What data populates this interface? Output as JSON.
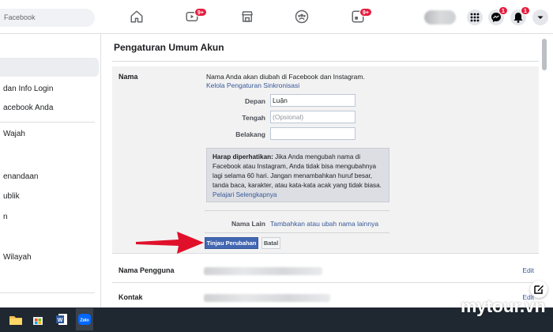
{
  "topbar": {
    "search_text": "Facebook",
    "notifications_badges": {
      "video": "9+",
      "groups_gaming": "9+",
      "messenger": "1",
      "notifications": "1"
    }
  },
  "sidebar": {
    "items": [
      {
        "label": "dan Info Login"
      },
      {
        "label": "acebook Anda"
      },
      {
        "label": "Wajah"
      },
      {
        "label": "enandaan"
      },
      {
        "label": "ublik"
      },
      {
        "label": "n"
      },
      {
        "label": "Wilayah"
      }
    ]
  },
  "main": {
    "title": "Pengaturan Umum Akun",
    "name_section": {
      "label": "Nama",
      "intro": "Nama Anda akan diubah di Facebook dan Instagram.",
      "sync_link": "Kelola Pengaturan Sinkronisasi",
      "first_label": "Depan",
      "first_value": "Luận",
      "middle_label": "Tengah",
      "middle_placeholder": "(Opsional)",
      "last_label": "Belakang",
      "last_value": "",
      "notice_bold": "Harap diperhatikan:",
      "notice_text": "Jika Anda mengubah nama di Facebook atau Instagram, Anda tidak bisa mengubahnya lagi selama 60 hari. Jangan menambahkan huruf besar, tanda baca, karakter, atau kata-kata acak yang tidak biasa.",
      "notice_link": "Pelajari Selengkapnya",
      "other_names_label": "Nama Lain",
      "other_names_link": "Tambahkan atau ubah nama lainnya",
      "review_button": "Tinjau Perubahan",
      "cancel_button": "Batal"
    },
    "rows": [
      {
        "label": "Nama Pengguna",
        "edit": "Edit"
      },
      {
        "label": "Kontak",
        "edit": "Edit"
      }
    ]
  },
  "watermark": "mytour.vn",
  "colors": {
    "facebook_blue": "#4267b2",
    "link": "#385898",
    "badge_red": "#e41e3f",
    "arrow_red": "#e0102b"
  }
}
